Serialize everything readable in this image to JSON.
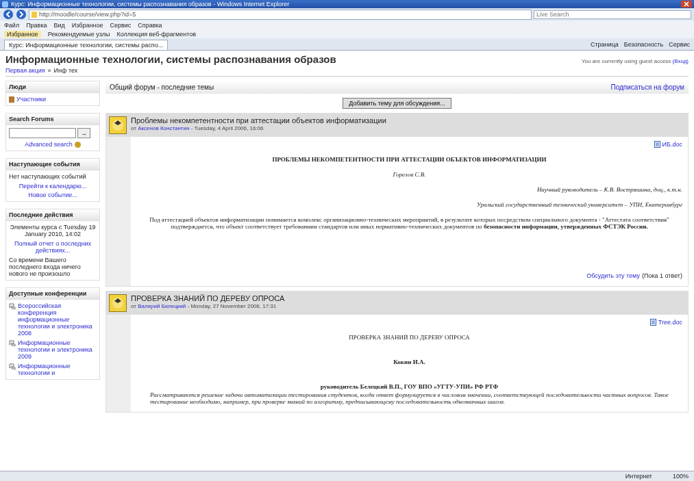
{
  "window": {
    "title": "Курс: Информационные технологии, системы распознавания образов - Windows Internet Explorer"
  },
  "address_bar": {
    "value": "http://moodle/course/view.php?id=5",
    "search_placeholder": "Live Search"
  },
  "menu": [
    "Файл",
    "Правка",
    "Вид",
    "Избранное",
    "Сервис",
    "Справка"
  ],
  "favorites_bar": {
    "label": "Избранное",
    "links": [
      "Рекомендуемые узлы",
      "Коллекция веб-фрагментов"
    ]
  },
  "tab": {
    "title": "Курс: Информационные технологии, системы распо...",
    "selected": true
  },
  "command_bar": [
    "Страница",
    "Безопасность",
    "Сервис"
  ],
  "page": {
    "title": "Информационные технологии, системы распознавания образов",
    "login_info": "You are currently using guest access",
    "login_link": "(Вход)",
    "breadcrumb_separator": "»",
    "breadcrumb": [
      {
        "label": "Первая акция",
        "link": true
      },
      {
        "label": "Инф тех",
        "link": false
      }
    ]
  },
  "sidebar": [
    {
      "kind": "links",
      "title": "Люди",
      "items": [
        "Участники"
      ]
    },
    {
      "kind": "search",
      "title": "Search Forums",
      "button": "→",
      "link": "Advanced search"
    },
    {
      "kind": "text",
      "title": "Наступающие события",
      "text": "Нет наступающих событий",
      "links": [
        "Перейти к календарю...",
        "Новое событие..."
      ]
    },
    {
      "kind": "activity",
      "title": "Последние действия",
      "text": "Элементы курса с Tuesday 19 January 2010, 14:02",
      "link": "Полный отчет о последних действиях...",
      "note": "Со времени Вашего последнего входа ничего нового не произошло"
    },
    {
      "kind": "forums",
      "title": "Доступные конференции",
      "items": [
        "Всероссийская конференция информационные технологии и электроника 2008",
        "Информационные технологии и электроника 2009",
        "Информационные технологии и"
      ]
    }
  ],
  "forum": {
    "title": "Общий форум - последние темы",
    "subscribe": "Подписаться на форум",
    "add_button": "Добавить тему для обсуждения...",
    "posts": [
      {
        "subject": "Проблемы некомпетентности при аттестации объектов информатизации",
        "by": "от",
        "author": "Аксенов Константин",
        "date": " - Tuesday, 4 April 2006, 16:06",
        "attachment": "ИБ.doc",
        "lines": [
          {
            "kind": "heading",
            "text": "ПРОБЛЕМЫ НЕКОМПЕТЕНТНОСТИ ПРИ АТТЕСТАЦИИ ОБЪЕКТОВ ИНФОРМАТИЗАЦИИ"
          },
          {
            "kind": "center-italic",
            "text": "Горелов С.В."
          },
          {
            "kind": "right-italic",
            "text": "Научный руководитель – К.В. Востряшина, доц., к.т.н."
          },
          {
            "kind": "right-italic",
            "text": "Уральский государственный технический университет – УПИ, Екатеринбург"
          },
          {
            "kind": "paragraph",
            "text": "Под аттестацией объектов информатизации понимается комплекс организационно-технических мероприятий, в результате которых посредством специального документа - \"Аттестата соответствия\" подтверждается, что объект соответствует требованиям стандартов или иных нормативно-технических документов по **безопасности информации, утвержденных ФСТЭК России.**"
          }
        ],
        "discuss": "Обсудить эту тему",
        "replies": "(Пока 1 ответ)"
      },
      {
        "subject": "ПРОВЕРКА ЗНАНИЙ ПО ДЕРЕВУ ОПРОСА",
        "by": "от",
        "author": "Валерий Белецкий",
        "date": " - Monday, 27 November 2006, 17:31",
        "attachment": "Tree.doc",
        "lines": [
          {
            "kind": "heading-plain",
            "text": "ПРОВЕРКА ЗНАНИЙ ПО ДЕРЕВУ ОПРОСА"
          },
          {
            "kind": "center-bold",
            "text": "Кокин И.А."
          },
          {
            "kind": "center-bold",
            "text": "руководитель Белецкий В.П., ГОУ ВПО «УГТУ-УПИ» РФ РТФ"
          },
          {
            "kind": "justify-italic",
            "text": "Рассматриваются решение задачи автоматизации тестирования студентов, когда ответ формулируется в числовом значении, соответствующей последовательности частных вопросов. Такое тестирование необходимо, например, при проверке знаний по алгоритму, предписывающему последовательность однозначных шагов."
          }
        ]
      }
    ]
  },
  "status_bar": {
    "zone": "Интернет",
    "zoom": "100%"
  }
}
